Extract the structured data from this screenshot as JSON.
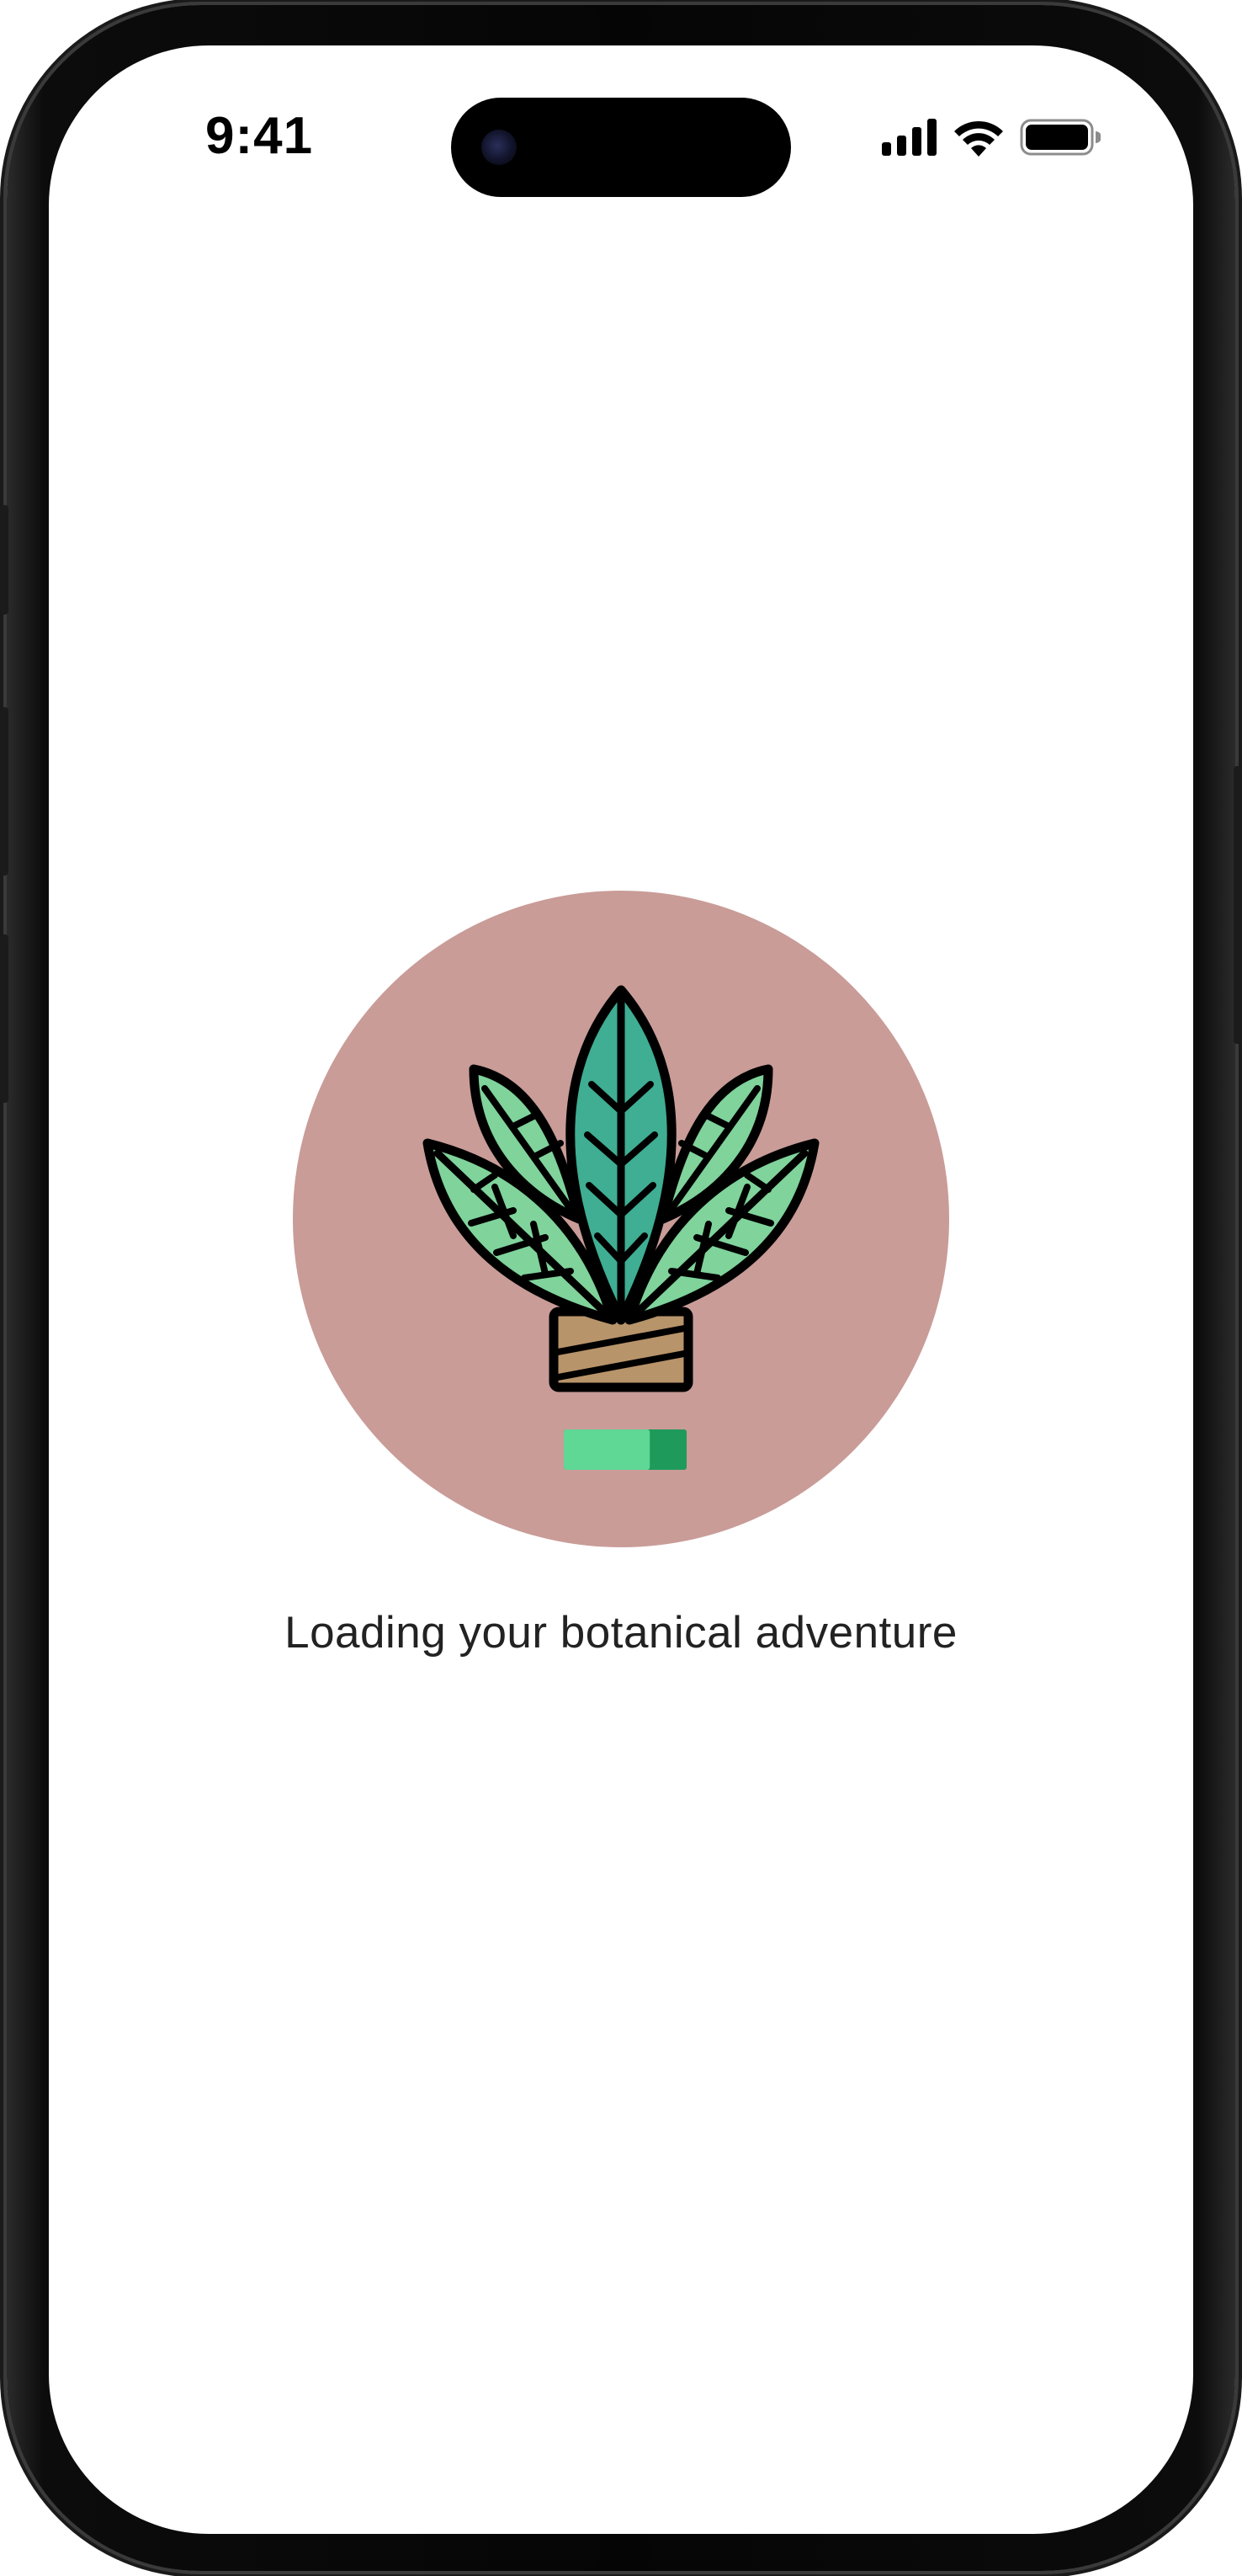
{
  "status_bar": {
    "time": "9:41",
    "icons": [
      "cellular-signal-icon",
      "wifi-icon",
      "battery-icon"
    ]
  },
  "splash": {
    "loading_message": "Loading your botanical adventure",
    "loading_progress": 0.7,
    "illustration": "potted-plant-icon",
    "colors": {
      "circle_background": "#C99C98",
      "leaf_light": "#7FD39B",
      "leaf_dark": "#3FAE93",
      "pot_wrap": "#B8946A",
      "progress_fill": "#5FD795",
      "progress_track": "#1E9B5A",
      "outline": "#000000"
    }
  }
}
